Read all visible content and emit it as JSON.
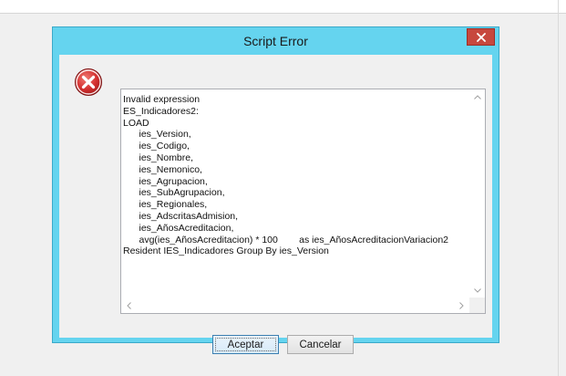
{
  "dialog": {
    "title": "Script Error",
    "close_icon": "close-icon",
    "error_icon": "error-icon",
    "error_icon_color": "#d32f2f",
    "message_lines": [
      "Invalid expression",
      "ES_Indicadores2:",
      "LOAD",
      "      ies_Version,",
      "      ies_Codigo,",
      "      ies_Nombre,",
      "      ies_Nemonico,",
      "      ies_Agrupacion,",
      "      ies_SubAgrupacion,",
      "      ies_Regionales,",
      "      ies_AdscritasAdmision,",
      "      ies_AñosAcreditacion,",
      "      avg(ies_AñosAcreditacion) * 100        as ies_AñosAcreditacionVariacion2",
      "Resident IES_Indicadores Group By ies_Version"
    ],
    "buttons": {
      "accept_label": "Aceptar",
      "cancel_label": "Cancelar"
    }
  }
}
